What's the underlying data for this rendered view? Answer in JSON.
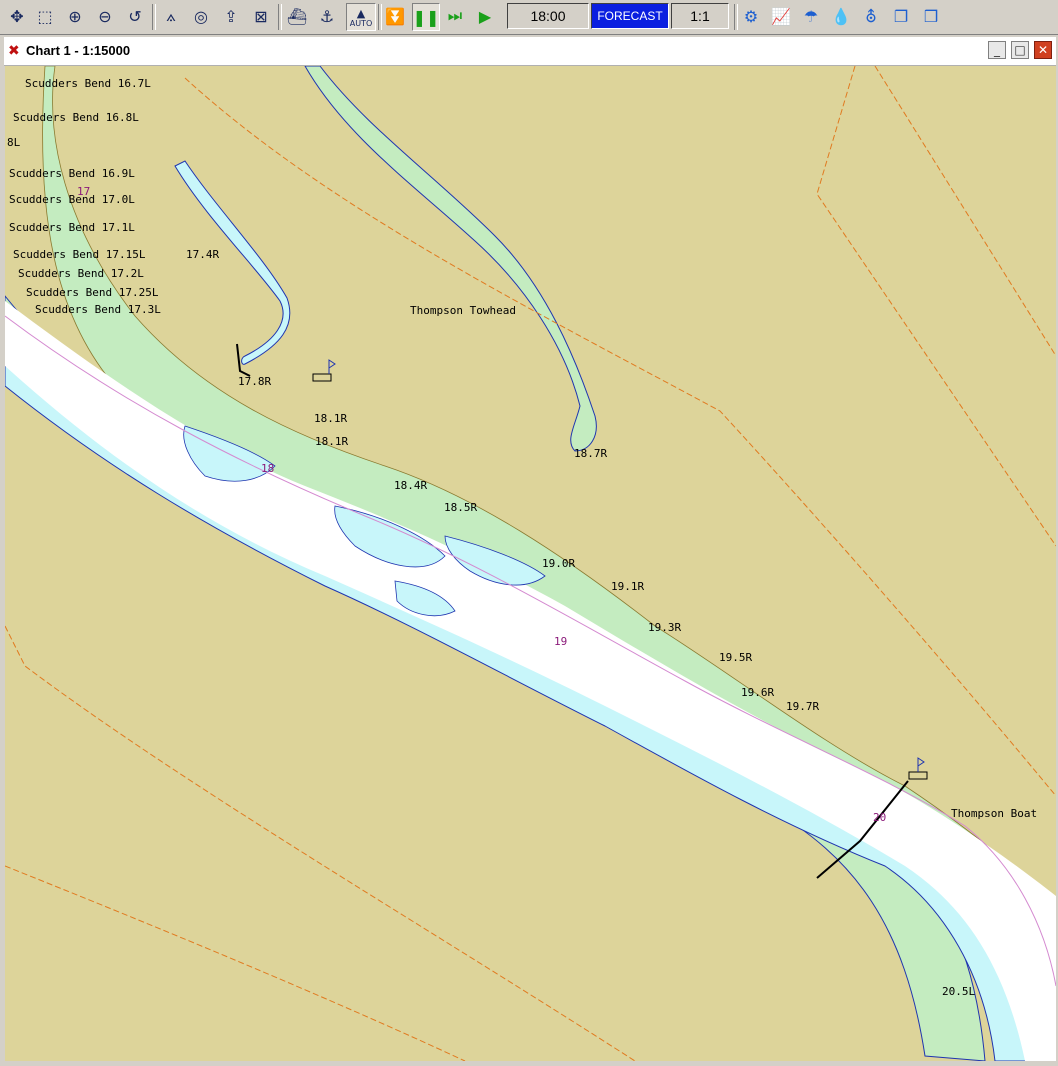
{
  "toolbar": {
    "time": "18:00",
    "forecast_label": "FORECAST",
    "ratio": "1:1",
    "auto_label": "AUTO"
  },
  "window": {
    "title": "Chart 1 - 1:15000"
  },
  "map": {
    "bank_labels": [
      "Scudders Bend 16.7L",
      "Scudders Bend 16.8L",
      "8L",
      "Scudders Bend 16.9L",
      "Scudders Bend 17.0L",
      "Scudders Bend 17.1L",
      "Scudders Bend 17.15L",
      "Scudders Bend 17.2L",
      "Scudders Bend 17.25L",
      "Scudders Bend 17.3L",
      "17.4R",
      "17.8R",
      "18.1R",
      "18.1R",
      "18.4R",
      "18.5R",
      "18.7R",
      "19.0R",
      "19.1R",
      "19.3R",
      "19.5R",
      "19.6R",
      "19.7R",
      "20.5L"
    ],
    "mile_markers": [
      "17",
      "18",
      "19",
      "20"
    ],
    "place_labels": [
      "Thompson Towhead",
      "Thompson Boat"
    ],
    "colors": {
      "land": "#ddd49a",
      "shallow_bank": "#c4ecc0",
      "shallow_water": "#c8f6fa",
      "channel": "#ffffff",
      "sailing_line": "#d48ad0",
      "boundary": "#e07a20",
      "shoreline": "#1f35b0"
    }
  }
}
